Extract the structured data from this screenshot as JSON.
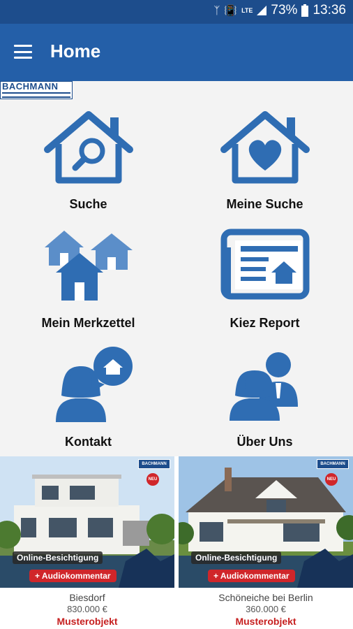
{
  "status_bar": {
    "battery": "73%",
    "time": "13:36",
    "network": "LTE"
  },
  "app_bar": {
    "title": "Home",
    "logo_text": "BACHMANN"
  },
  "menu": [
    {
      "label": "Suche",
      "icon": "house-search-icon"
    },
    {
      "label": "Meine Suche",
      "icon": "house-heart-icon"
    },
    {
      "label": "Mein Merkzettel",
      "icon": "houses-icon"
    },
    {
      "label": "Kiez Report",
      "icon": "newspaper-icon"
    },
    {
      "label": "Kontakt",
      "icon": "contact-person-icon"
    },
    {
      "label": "Über Uns",
      "icon": "team-icon"
    }
  ],
  "listings": [
    {
      "city": "Biesdorf",
      "price": "830.000 €",
      "tag": "Musterobjekt",
      "badge_online": "Online-Besichtigung",
      "badge_audio": "Audiokommentar",
      "neu": "NEU",
      "brand": "BACHMANN"
    },
    {
      "city": "Schöneiche bei Berlin",
      "price": "360.000 €",
      "tag": "Musterobjekt",
      "badge_online": "Online-Besichtigung",
      "badge_audio": "Audiokommentar",
      "neu": "NEU",
      "brand": "BACHMANN"
    }
  ],
  "colors": {
    "status_bar": "#1d4d8c",
    "app_bar": "#245fa8",
    "icon_blue": "#2f6db3",
    "icon_light": "#5b8ec9",
    "tag_red": "#c62020"
  }
}
